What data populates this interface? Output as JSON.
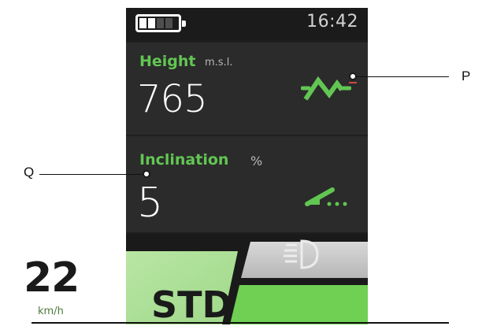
{
  "status_bar": {
    "time": "16:42",
    "battery_level": 0.4
  },
  "height_panel": {
    "label": "Height",
    "unit": "m.s.l.",
    "value": "765",
    "icon": "mountain-icon"
  },
  "inclination_panel": {
    "label": "Inclination",
    "unit": "%",
    "value": "5",
    "icon": "slope-icon"
  },
  "speed": {
    "value": "22",
    "unit": "km/h"
  },
  "light": {
    "icon": "headlight-icon"
  },
  "mode": {
    "label": "STD"
  },
  "callouts": {
    "p": "P",
    "q": "Q"
  },
  "colors": {
    "accent_green": "#62c653",
    "bright_green": "#7ed957",
    "panel_bg": "#2b2b2b",
    "screen_bg": "#1f1f1f"
  }
}
